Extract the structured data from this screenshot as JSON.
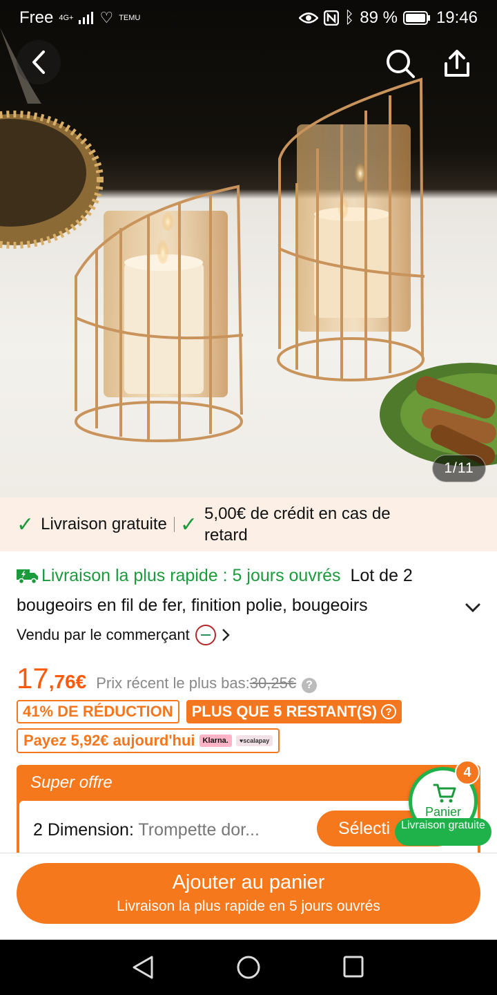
{
  "status_bar": {
    "carrier": "Free",
    "network": "4G+",
    "app_badge": "TEMU",
    "battery": "89 %",
    "time": "19:46"
  },
  "gallery": {
    "counter": "1/11"
  },
  "banner": {
    "free_shipping": "Livraison gratuite",
    "credit": "5,00€ de crédit en cas de retard"
  },
  "product": {
    "fast_delivery": "Livraison la plus rapide : 5 jours ouvrés",
    "title": "Lot de 2 bougeoirs en fil de fer, finition polie, bougeoirs",
    "seller": "Vendu par le commerçant"
  },
  "price": {
    "integer": "17",
    "decimal": ",76€",
    "recent_label": "Prix récent le plus bas:",
    "recent_value": "30,25€"
  },
  "tags": {
    "discount": "41% DE RÉDUCTION",
    "stock": "PLUS QUE 5 RESTANT(S)",
    "pay_today": "Payez 5,92€ aujourd'hui",
    "klarna": "Klarna.",
    "scalapay": "♥scalapay"
  },
  "offer": {
    "label": "Super offre",
    "dimension_label": "2 Dimension:",
    "dimension_value": "Trompette dor...",
    "select_label": "Sélecti"
  },
  "cart": {
    "label": "Panier",
    "count": "4",
    "pill": "Livraison gratuite"
  },
  "bottom": {
    "add_to_cart": "Ajouter au panier",
    "add_to_cart_sub": "Livraison la plus rapide en 5 jours ouvrés"
  },
  "colors": {
    "accent_orange": "#f6781c",
    "price_orange": "#fb5a0a",
    "green": "#1b9a3c"
  }
}
